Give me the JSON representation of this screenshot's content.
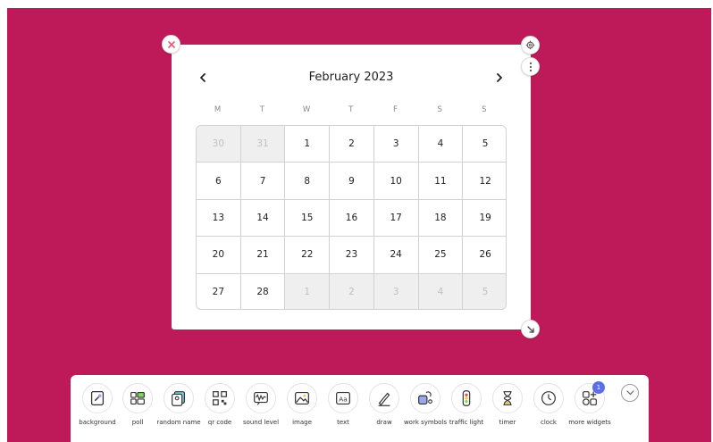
{
  "colors": {
    "background": "#be1a5a",
    "accent_badge": "#5b6ee8"
  },
  "widget": {
    "close_icon": "close-icon",
    "settings_icon": "gear-icon",
    "menu_icon": "vertical-dots-icon",
    "resize_icon": "resize-icon"
  },
  "calendar": {
    "month_title": "February 2023",
    "prev_icon": "chevron-left-icon",
    "next_icon": "chevron-right-icon",
    "weekdays": [
      "M",
      "T",
      "W",
      "T",
      "F",
      "S",
      "S"
    ],
    "weeks": [
      [
        {
          "d": "30",
          "o": true
        },
        {
          "d": "31",
          "o": true
        },
        {
          "d": "1"
        },
        {
          "d": "2"
        },
        {
          "d": "3"
        },
        {
          "d": "4"
        },
        {
          "d": "5"
        }
      ],
      [
        {
          "d": "6"
        },
        {
          "d": "7"
        },
        {
          "d": "8"
        },
        {
          "d": "9"
        },
        {
          "d": "10"
        },
        {
          "d": "11"
        },
        {
          "d": "12"
        }
      ],
      [
        {
          "d": "13"
        },
        {
          "d": "14"
        },
        {
          "d": "15"
        },
        {
          "d": "16"
        },
        {
          "d": "17"
        },
        {
          "d": "18"
        },
        {
          "d": "19"
        }
      ],
      [
        {
          "d": "20"
        },
        {
          "d": "21"
        },
        {
          "d": "22"
        },
        {
          "d": "23"
        },
        {
          "d": "24"
        },
        {
          "d": "25"
        },
        {
          "d": "26"
        }
      ],
      [
        {
          "d": "27"
        },
        {
          "d": "28"
        },
        {
          "d": "1",
          "o": true
        },
        {
          "d": "2",
          "o": true
        },
        {
          "d": "3",
          "o": true
        },
        {
          "d": "4",
          "o": true
        },
        {
          "d": "5",
          "o": true
        }
      ]
    ]
  },
  "toolbar": {
    "tools": [
      {
        "label": "background",
        "icon": "background-icon"
      },
      {
        "label": "poll",
        "icon": "poll-icon"
      },
      {
        "label": "random name",
        "icon": "random-name-icon"
      },
      {
        "label": "qr code",
        "icon": "qr-code-icon"
      },
      {
        "label": "sound level",
        "icon": "sound-level-icon"
      },
      {
        "label": "image",
        "icon": "image-icon"
      },
      {
        "label": "text",
        "icon": "text-icon"
      },
      {
        "label": "draw",
        "icon": "draw-icon"
      },
      {
        "label": "work symbols",
        "icon": "work-symbols-icon"
      },
      {
        "label": "traffic light",
        "icon": "traffic-light-icon"
      },
      {
        "label": "timer",
        "icon": "hourglass-icon"
      },
      {
        "label": "clock",
        "icon": "clock-icon"
      },
      {
        "label": "more widgets",
        "icon": "more-widgets-icon"
      }
    ],
    "more_badge": "1",
    "collapse_icon": "chevron-down-icon"
  }
}
